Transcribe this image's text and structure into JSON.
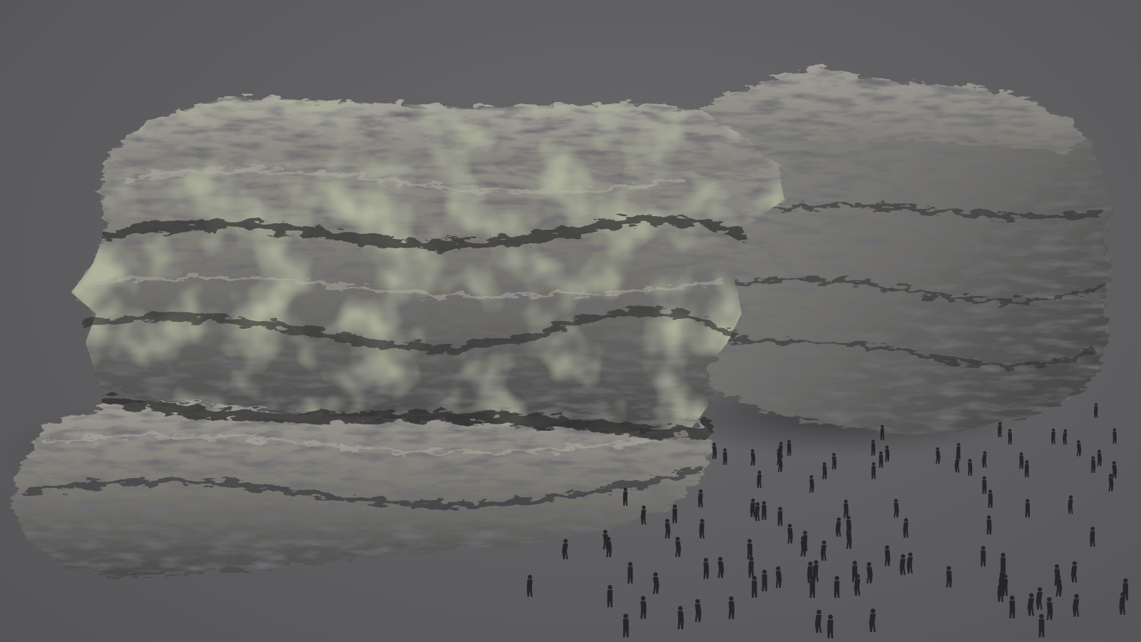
{
  "scene": {
    "subject": "rock-cliff-assets",
    "rocks": [
      {
        "name": "front-rock-formation",
        "layers": 4
      },
      {
        "name": "back-rock-formation",
        "layers": 3
      }
    ],
    "crowd": {
      "name": "human-scale-silhouettes",
      "count": 110
    },
    "colors": {
      "background": "#5f5f61",
      "rock_light": "#9b9891",
      "rock_mid": "#6f6d68",
      "rock_dark": "#2e2e30",
      "moss": "#6f7258",
      "shadow": "#3f3f42",
      "silhouette": "#262628"
    }
  }
}
